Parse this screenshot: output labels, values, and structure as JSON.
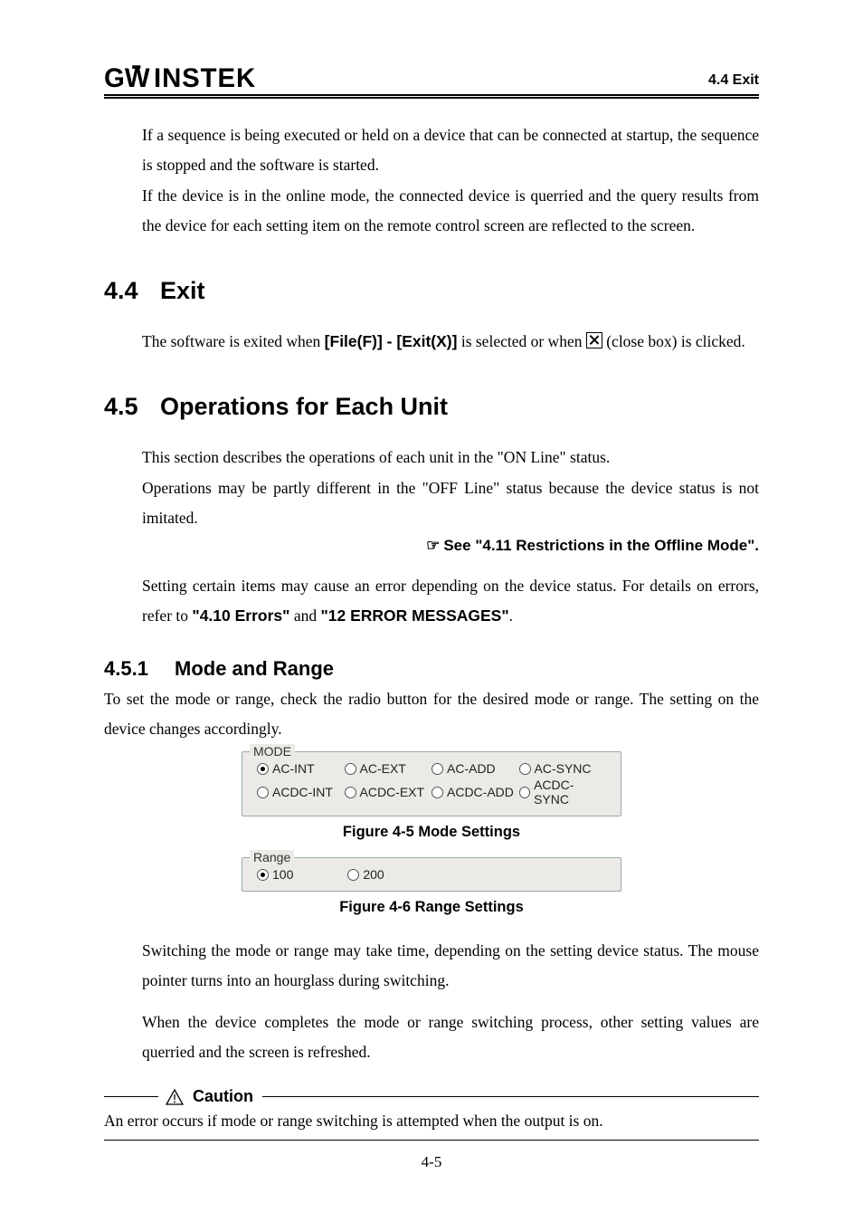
{
  "header": {
    "logo_text": "GWINSTEK",
    "right": "4.4 Exit"
  },
  "intro": {
    "p1": "If a sequence is being executed or held on a device that can be connected at startup, the sequence is stopped and the software is started.",
    "p2": "If the device is in the online mode, the connected device is querried and the query results from the device for each setting item on the remote control screen are reflected to the screen."
  },
  "s44": {
    "num": "4.4",
    "title": "Exit",
    "body_pre": "The software is exited when ",
    "body_strong": "[File(F)] - [Exit(X)]",
    "body_mid": " is selected or when ",
    "body_post": " (close box) is clicked."
  },
  "s45": {
    "num": "4.5",
    "title": "Operations for Each Unit",
    "p1": "This section describes the operations of each unit in the \"ON Line\" status.",
    "p2": "Operations may be partly different in the \"OFF Line\" status because the device status is not imitated.",
    "see": "See \"4.11 Restrictions in the Offline Mode\".",
    "p3a": "Setting certain items may cause an error depending on the device status.  For details on errors, refer to ",
    "p3b": "\"4.10 Errors\"",
    "p3c": " and ",
    "p3d": "\"12 ERROR MESSAGES\"",
    "p3e": "."
  },
  "s451": {
    "num": "4.5.1",
    "title": "Mode and Range",
    "p1": "To set the mode or range, check the radio button for the desired mode or range. The setting on the device changes accordingly."
  },
  "fig_mode": {
    "legend": "MODE",
    "row1": [
      "AC-INT",
      "AC-EXT",
      "AC-ADD",
      "AC-SYNC"
    ],
    "row2": [
      "ACDC-INT",
      "ACDC-EXT",
      "ACDC-ADD",
      "ACDC-SYNC"
    ],
    "selected": "AC-INT",
    "caption": "Figure 4-5  Mode Settings"
  },
  "fig_range": {
    "legend": "Range",
    "options": [
      "100",
      "200"
    ],
    "selected": "100",
    "caption": "Figure 4-6  Range Settings"
  },
  "post_fig": {
    "p1": "Switching the mode or range may take time, depending on the setting device status. The mouse pointer turns into an hourglass during switching.",
    "p2": "When the device completes the mode or range switching process, other setting values are querried and the screen is refreshed."
  },
  "caution": {
    "label": "Caution",
    "text": "An error occurs if mode or range switching is attempted when the output is on."
  },
  "footer": "4-5"
}
